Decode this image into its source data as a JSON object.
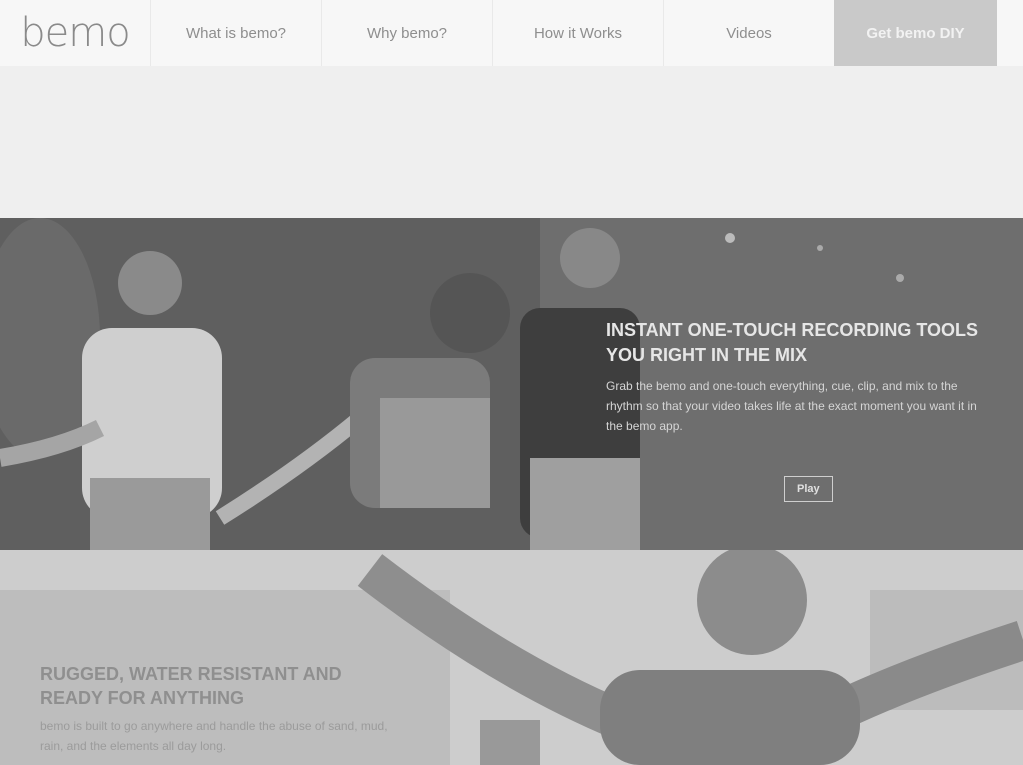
{
  "nav": {
    "logo": "bemo",
    "items": [
      {
        "label": "What is bemo?"
      },
      {
        "label": "Why bemo?"
      },
      {
        "label": "How it Works"
      },
      {
        "label": "Videos"
      }
    ],
    "cta_label": "Get bemo DIY"
  },
  "hero": {
    "title": "Instant one-touch recording tools you right in the mix",
    "body": "Grab the bemo and one-touch everything, cue, clip, and mix to the rhythm so that your video takes life at the exact moment you want it in the bemo app.",
    "button_label": "Play"
  },
  "lower": {
    "title": "Rugged, water resistant and ready for anything",
    "body": "bemo is built to go anywhere and handle the abuse of sand, mud, rain, and the elements all day long."
  },
  "colors": {
    "nav_bg": "#f7f7f7",
    "cta_bg": "#c9c9c9",
    "page_bg": "#efefef"
  }
}
